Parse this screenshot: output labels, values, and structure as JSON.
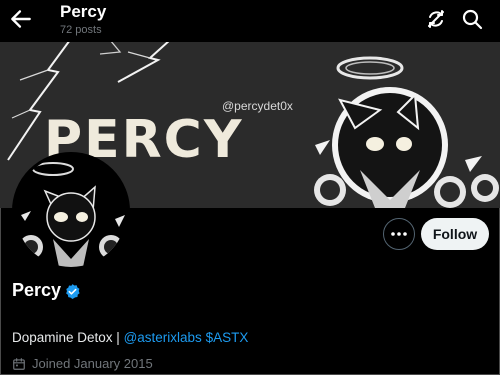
{
  "header": {
    "title": "Percy",
    "posts": "72 posts"
  },
  "banner": {
    "handle": "@percydet0x",
    "title": "PERCY"
  },
  "actions": {
    "follow_label": "Follow"
  },
  "profile": {
    "name": "Percy",
    "bio_prefix": "Dopamine Detox | ",
    "bio_mention": "@asterixlabs",
    "bio_cashtag": "$ASTX",
    "joined": "Joined January 2015"
  },
  "colors": {
    "accent": "#1d9bf0",
    "background": "#000000",
    "banner": "#2b2b2b",
    "follow_bg": "#eff3f4"
  },
  "icons": {
    "back": "arrow-left-icon",
    "refresh": "refresh-icon",
    "search": "search-icon",
    "more": "more-horizontal-icon",
    "verified": "verified-badge-icon",
    "calendar": "calendar-icon"
  }
}
